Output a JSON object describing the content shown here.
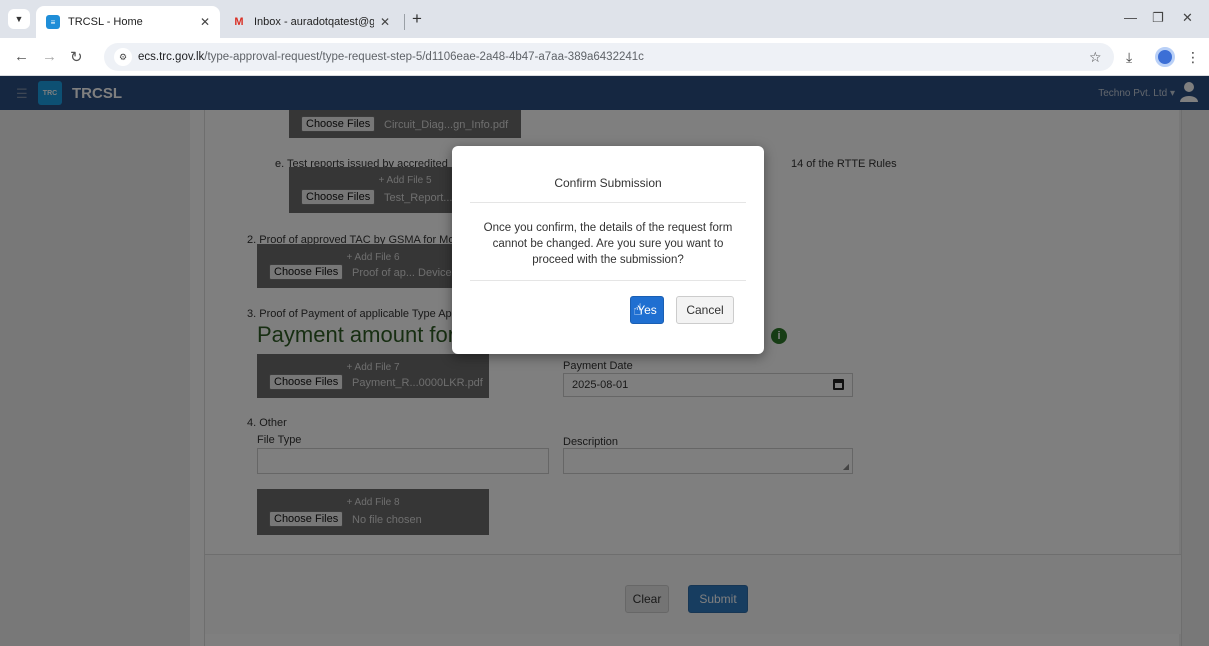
{
  "browser": {
    "tabs": [
      {
        "title": "TRCSL - Home",
        "active": true
      },
      {
        "title": "Inbox - auradotqatest@gmail.c",
        "active": false
      }
    ],
    "new_tab": "+",
    "url_host": "ecs.trc.gov.lk",
    "url_path": "/type-approval-request/type-request-step-5/d1106eae-2a48-4b47-a7aa-389a6432241c"
  },
  "app": {
    "brand": "TRCSL",
    "logo_text": "TRC",
    "company": "Techno Pvt. Ltd"
  },
  "form": {
    "file4": {
      "choose": "Choose Files",
      "file": "Circuit_Diag...gn_Info.pdf"
    },
    "item_e_label": "e. Test reports issued by accredited",
    "item_e_suffix": "14 of the RTTE Rules",
    "file5": {
      "add": "+ Add File 5",
      "choose": "Choose Files",
      "file": "Test_Report...1"
    },
    "item2_label": "2. Proof of approved TAC by GSMA for Mo",
    "file6": {
      "add": "+ Add File 6",
      "choose": "Choose Files",
      "file": "Proof of ap... Device"
    },
    "item3_label": "3. Proof of Payment of applicable Type App",
    "payment_heading": "Payment amount for the",
    "file7": {
      "add": "+ Add File 7",
      "choose": "Choose Files",
      "file": "Payment_R...0000LKR.pdf"
    },
    "payment_date_label": "Payment Date",
    "payment_date_value": "2025-08-01",
    "item4_label": "4. Other",
    "file_type_label": "File Type",
    "description_label": "Description",
    "file8": {
      "add": "+ Add File 8",
      "choose": "Choose Files",
      "file": "No file chosen"
    },
    "clear_label": "Clear",
    "submit_label": "Submit"
  },
  "modal": {
    "title": "Confirm Submission",
    "body": "Once you confirm, the details of the request form cannot be changed. Are you sure you want to proceed with the submission?",
    "yes_label": "Yes",
    "cancel_label": "Cancel"
  }
}
